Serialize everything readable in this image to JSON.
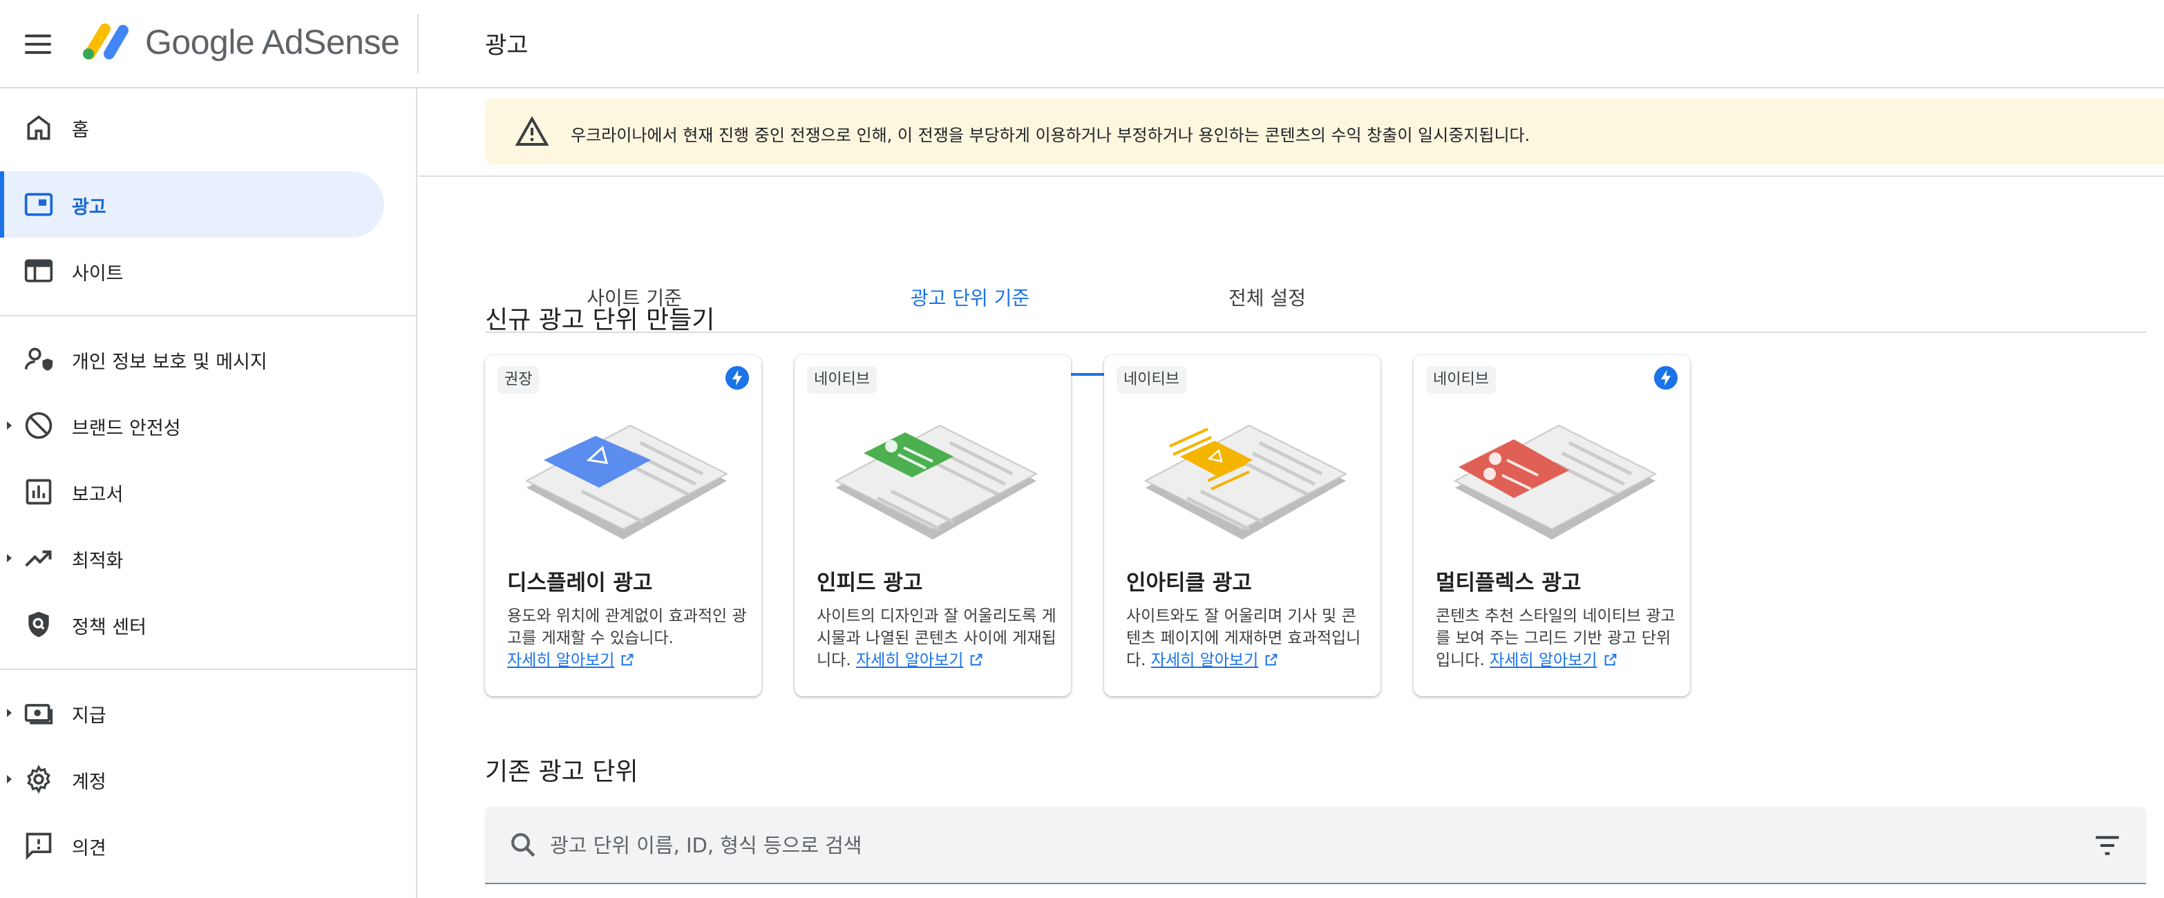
{
  "header": {
    "app_name": "Google AdSense",
    "page_title": "광고"
  },
  "sidebar": {
    "items": [
      {
        "label": "홈",
        "icon": "home-icon"
      },
      {
        "label": "광고",
        "icon": "ads-icon",
        "active": true
      },
      {
        "label": "사이트",
        "icon": "sites-icon"
      },
      {
        "label": "개인 정보 보호 및 메시지",
        "icon": "privacy-messaging-icon"
      },
      {
        "label": "브랜드 안전성",
        "icon": "block-icon",
        "expandable": true
      },
      {
        "label": "보고서",
        "icon": "reports-icon"
      },
      {
        "label": "최적화",
        "icon": "trending-up-icon",
        "expandable": true
      },
      {
        "label": "정책 센터",
        "icon": "policy-shield-icon"
      },
      {
        "label": "지급",
        "icon": "payments-icon",
        "expandable": true
      },
      {
        "label": "계정",
        "icon": "gear-icon",
        "expandable": true
      },
      {
        "label": "의견",
        "icon": "feedback-icon"
      }
    ]
  },
  "alert": {
    "text": "우크라이나에서 현재 진행 중인 전쟁으로 인해, 이 전쟁을 부당하게 이용하거나 부정하거나 용인하는 콘텐츠의 수익 창출이 일시중지됩니다."
  },
  "tabs": [
    {
      "label": "사이트 기준"
    },
    {
      "label": "광고 단위 기준",
      "active": true
    },
    {
      "label": "전체 설정"
    }
  ],
  "create_section": {
    "title": "신규 광고 단위 만들기",
    "learn_more": "자세히 알아보기",
    "cards": [
      {
        "badge": "권장",
        "title": "디스플레이 광고",
        "desc": "용도와 위치에 관계없이 효과적인 광고를 게재할 수 있습니다.",
        "accent": "#5b8def"
      },
      {
        "badge": "네이티브",
        "title": "인피드 광고",
        "desc": "사이트의 디자인과 잘 어울리도록 게시물과 나열된 콘텐츠 사이에 게재됩니다.",
        "accent": "#4caf50"
      },
      {
        "badge": "네이티브",
        "title": "인아티클 광고",
        "desc": "사이트와도 잘 어울리며 기사 및 콘텐츠 페이지에 게재하면 효과적입니다.",
        "accent": "#f4b400"
      },
      {
        "badge": "네이티브",
        "title": "멀티플렉스 광고",
        "desc": "콘텐츠 추천 스타일의 네이티브 광고를 보여 주는 그리드 기반 광고 단위입니다.",
        "accent": "#e06055"
      }
    ]
  },
  "existing_section": {
    "title": "기존 광고 단위",
    "search_placeholder": "광고 단위 이름, ID, 형식 등으로 검색"
  },
  "colors": {
    "primary": "#1a73e8",
    "active_nav_bg": "#e8f0fe",
    "alert_bg": "#fef7e0"
  }
}
